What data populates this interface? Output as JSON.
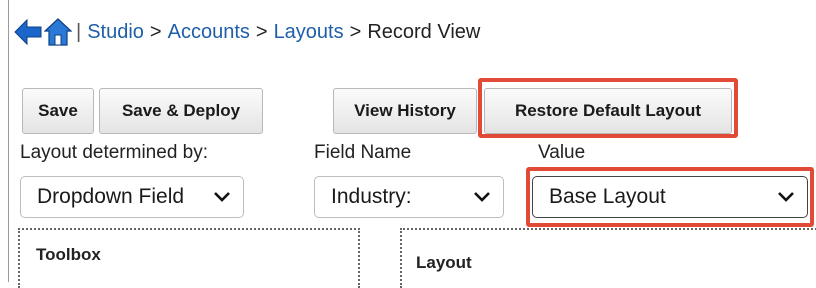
{
  "breadcrumb": {
    "separator": "|",
    "items": [
      "Studio",
      "Accounts",
      "Layouts"
    ],
    "arrow": ">",
    "current": "Record View"
  },
  "icons": {
    "back": "back-arrow-icon",
    "home": "home-icon",
    "dropdown": "chevron-down-icon"
  },
  "toolbar": {
    "save": "Save",
    "save_deploy": "Save & Deploy",
    "view_history": "View History",
    "restore_default": "Restore Default Layout"
  },
  "controls": {
    "layout_determined_label": "Layout determined by:",
    "layout_determined_value": "Dropdown Field",
    "field_name_label": "Field Name",
    "field_name_value": "Industry:",
    "value_label": "Value",
    "value_value": "Base Layout"
  },
  "panels": {
    "toolbox": "Toolbox",
    "layout": "Layout"
  },
  "colors": {
    "link": "#1f5fa8",
    "highlight": "#e04a36",
    "arrow_blue": "#1a66c9"
  }
}
